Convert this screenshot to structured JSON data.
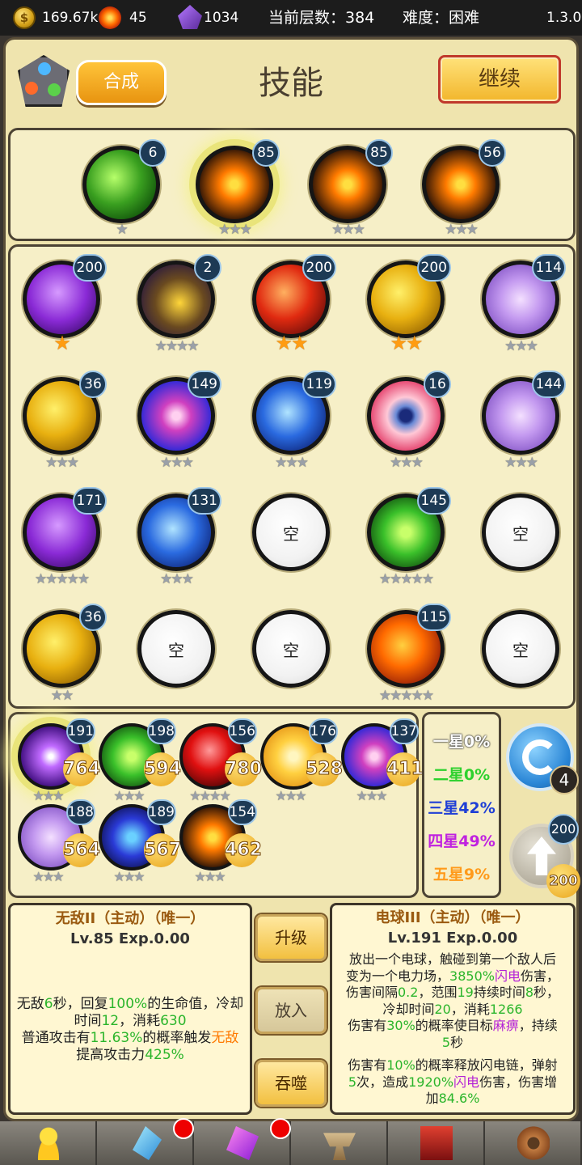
{
  "topbar": {
    "gold": "169.67k",
    "fire": "45",
    "gems": "1034",
    "floor_label": "当前层数：384",
    "difficulty_label": "难度：困难",
    "version": "1.3.0"
  },
  "header": {
    "compose_label": "合成",
    "title": "技能",
    "continue_label": "继续"
  },
  "equipped": [
    {
      "name": "green-vortex",
      "level": "6",
      "stars": 1,
      "gold": false
    },
    {
      "name": "fire-cross",
      "level": "85",
      "stars": 3,
      "gold": false,
      "selected": true
    },
    {
      "name": "fire-cross",
      "level": "85",
      "stars": 3,
      "gold": false
    },
    {
      "name": "fire-cross",
      "level": "56",
      "stars": 3,
      "gold": false
    }
  ],
  "grid": [
    {
      "name": "purple-lightning",
      "level": "200",
      "stars": 1,
      "gold": true
    },
    {
      "name": "dark-yellow",
      "level": "2",
      "stars": 4,
      "gold": false
    },
    {
      "name": "red-warrior",
      "level": "200",
      "stars": 2,
      "gold": true
    },
    {
      "name": "gold-shield",
      "level": "200",
      "stars": 2,
      "gold": true
    },
    {
      "name": "lilac-burst",
      "level": "114",
      "stars": 3,
      "gold": false
    },
    {
      "name": "gold-shield",
      "level": "36",
      "stars": 3,
      "gold": false
    },
    {
      "name": "magic-swirl",
      "level": "149",
      "stars": 3,
      "gold": false
    },
    {
      "name": "blue-ice",
      "level": "119",
      "stars": 3,
      "gold": false
    },
    {
      "name": "red-eye",
      "level": "16",
      "stars": 3,
      "gold": false
    },
    {
      "name": "lilac-burst",
      "level": "144",
      "stars": 3,
      "gold": false
    },
    {
      "name": "purple-lightning",
      "level": "171",
      "stars": 5,
      "gold": false
    },
    {
      "name": "blue-ice",
      "level": "131",
      "stars": 3,
      "gold": false
    },
    {
      "empty": true,
      "label": "空"
    },
    {
      "name": "green-skull",
      "level": "145",
      "stars": 5,
      "gold": false
    },
    {
      "empty": true,
      "label": "空"
    },
    {
      "name": "gold-shield",
      "level": "36",
      "stars": 2,
      "gold": false
    },
    {
      "empty": true,
      "label": "空"
    },
    {
      "empty": true,
      "label": "空"
    },
    {
      "name": "lava",
      "level": "115",
      "stars": 5,
      "gold": false
    },
    {
      "empty": true,
      "label": "空"
    }
  ],
  "shop": [
    {
      "name": "purple-star",
      "level": "191",
      "cost": "764",
      "stars": 3,
      "selected": true
    },
    {
      "name": "green-skull",
      "level": "198",
      "cost": "594",
      "stars": 3
    },
    {
      "name": "blood-drop",
      "level": "156",
      "cost": "780",
      "stars": 4
    },
    {
      "name": "sun-burst",
      "level": "176",
      "cost": "528",
      "stars": 3
    },
    {
      "name": "magic-swirl",
      "level": "137",
      "cost": "411",
      "stars": 3
    },
    {
      "name": "lilac-burst",
      "level": "188",
      "cost": "564",
      "stars": 3
    },
    {
      "name": "blue-slash",
      "level": "189",
      "cost": "567",
      "stars": 3
    },
    {
      "name": "fire-cross",
      "level": "154",
      "cost": "462",
      "stars": 3
    }
  ],
  "rates": [
    {
      "label": "一星0%",
      "color": "#ffffff"
    },
    {
      "label": "二星0%",
      "color": "#2ed12e"
    },
    {
      "label": "三星42%",
      "color": "#1f3fd6"
    },
    {
      "label": "四星49%",
      "color": "#c022e0"
    },
    {
      "label": "五星9%",
      "color": "#ff9a1a"
    }
  ],
  "refresh": {
    "count": "4"
  },
  "upgrade": {
    "level": "200",
    "cost": "200"
  },
  "left_desc": {
    "title": "无敌II（主动）（唯一）",
    "level": "Lv.85 Exp.0.00",
    "line1a": "无敌",
    "line1b": "6",
    "line1c": "秒，回复",
    "line1d": "100%",
    "line1e": "的生命值，冷却",
    "line2a": "时间",
    "line2b": "12",
    "line2c": "，消耗",
    "line2d": "630",
    "line3a": "普通攻击有",
    "line3b": "11.63%",
    "line3c": "的概率触发",
    "line3d": "无敌",
    "line4a": "提高攻击力",
    "line4b": "425%"
  },
  "actions": {
    "upgrade": "升级",
    "place": "放入",
    "devour": "吞噬"
  },
  "right_desc": {
    "title": "电球III（主动）（唯一）",
    "level": "Lv.191 Exp.0.00",
    "l1": "放出一个电球，触碰到第一个敌人后",
    "l2a": "变为一个电力场，",
    "l2b": "3850%",
    "l2c": "闪电",
    "l2d": "伤害，",
    "l3a": "伤害间隔",
    "l3b": "0.2",
    "l3c": "，范围",
    "l3d": "19",
    "l3e": "持续时间",
    "l3f": "8",
    "l3g": "秒，",
    "l4a": "冷却时间",
    "l4b": "20",
    "l4c": "，消耗",
    "l4d": "1266",
    "l5a": "伤害有",
    "l5b": "30%",
    "l5c": "的概率使目标",
    "l5d": "麻痹",
    "l5e": "，持续",
    "l6a": "5",
    "l6b": "秒",
    "l7a": "伤害有",
    "l7b": "10%",
    "l7c": "的概率释放闪电链，弹射",
    "l8a": "5",
    "l8b": "次，造成",
    "l8c": "1920%",
    "l8d": "闪电",
    "l8e": "伤害，伤害增",
    "l9a": "加",
    "l9b": "84.6%"
  },
  "nav": [
    {
      "name": "hero-tab",
      "icon": "person-icon"
    },
    {
      "name": "crystal-tab",
      "icon": "crystal-icon",
      "dot": true
    },
    {
      "name": "rune-tab",
      "icon": "rune-icon",
      "dot": true
    },
    {
      "name": "forge-tab",
      "icon": "anvil-icon"
    },
    {
      "name": "book-tab",
      "icon": "book-icon"
    },
    {
      "name": "settings-tab",
      "icon": "gear-icon"
    }
  ]
}
